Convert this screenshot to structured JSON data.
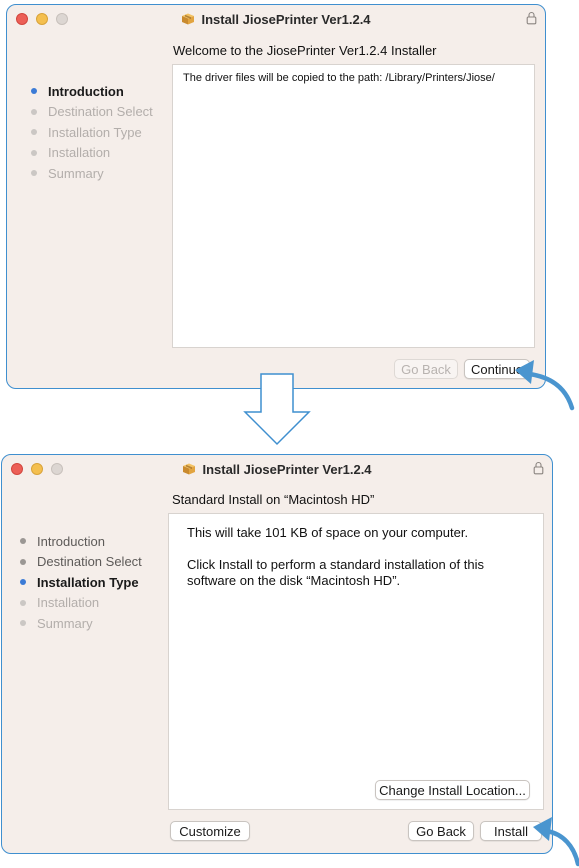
{
  "colors": {
    "window_border": "#3f8fcf",
    "window_bg": "#f5eeea",
    "active_step_dot": "#3b7bd6",
    "arrow": "#3f8fcf",
    "traffic_red": "#ec5f57",
    "traffic_yellow": "#f4bf4f"
  },
  "window1": {
    "title": "Install JiosePrinter Ver1.2.4",
    "subtitle": "Welcome to the JiosePrinter Ver1.2.4 Installer",
    "steps": [
      {
        "label": "Introduction",
        "state": "active"
      },
      {
        "label": "Destination Select",
        "state": "pending"
      },
      {
        "label": "Installation Type",
        "state": "pending"
      },
      {
        "label": "Installation",
        "state": "pending"
      },
      {
        "label": "Summary",
        "state": "pending"
      }
    ],
    "content_text": "The driver files will be copied to the path: /Library/Printers/Jiose/",
    "buttons": {
      "go_back": "Go Back",
      "continue": "Continue"
    }
  },
  "window2": {
    "title": "Install JiosePrinter Ver1.2.4",
    "subtitle": "Standard Install on “Macintosh HD”",
    "steps": [
      {
        "label": "Introduction",
        "state": "done"
      },
      {
        "label": "Destination Select",
        "state": "done"
      },
      {
        "label": "Installation Type",
        "state": "active"
      },
      {
        "label": "Installation",
        "state": "pending"
      },
      {
        "label": "Summary",
        "state": "pending"
      }
    ],
    "content_line1": "This will take 101 KB of space on your computer.",
    "content_line2": "Click Install to perform a standard installation of this software on the disk “Macintosh HD”.",
    "buttons": {
      "change_location": "Change Install Location...",
      "customize": "Customize",
      "go_back": "Go Back",
      "install": "Install"
    }
  }
}
